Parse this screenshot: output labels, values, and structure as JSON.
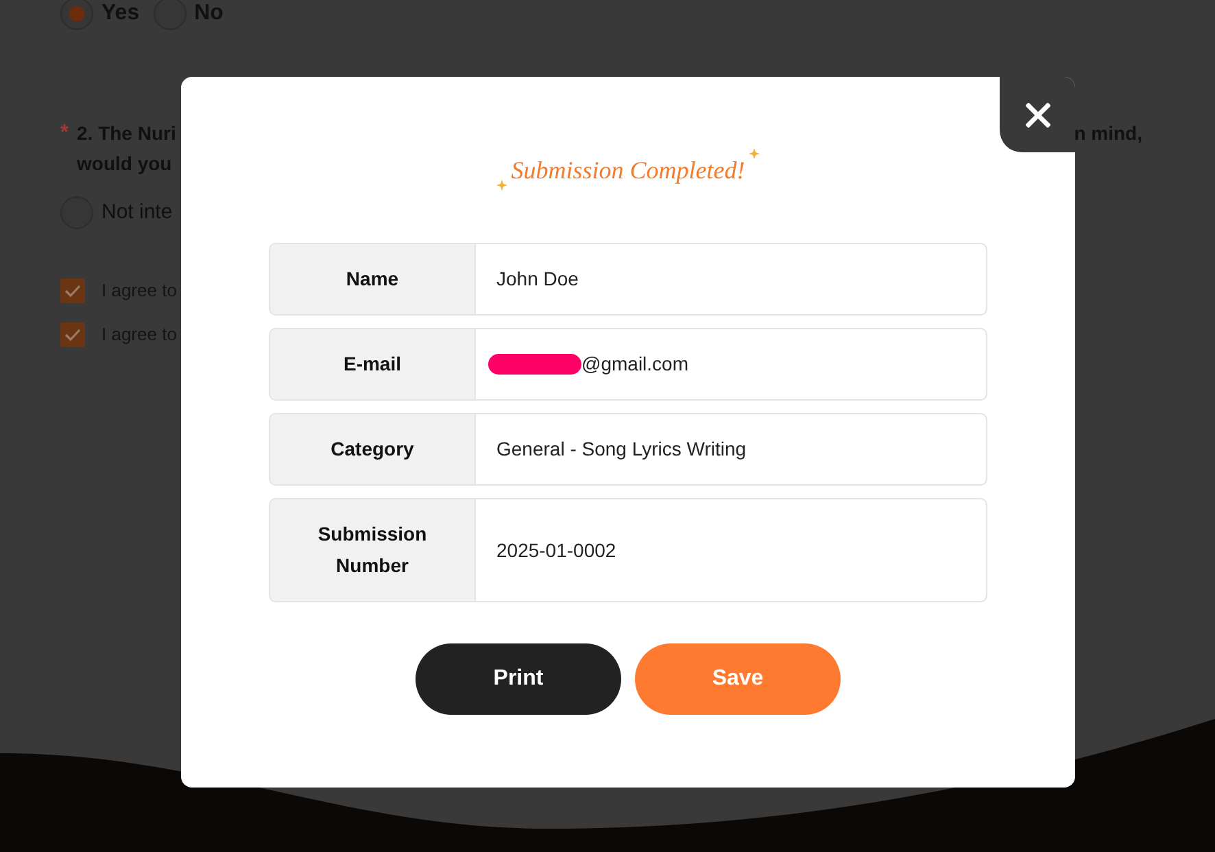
{
  "background_form": {
    "question_1_options": [
      {
        "label": "Yes",
        "selected": true
      },
      {
        "label": "No",
        "selected": false
      }
    ],
    "question_2": {
      "required_mark": "*",
      "text_left_lines": [
        "2. The Nuri",
        "would you"
      ],
      "text_right": "n mind,",
      "options": [
        {
          "label": "Not inte",
          "selected": false
        }
      ]
    },
    "agreements": [
      {
        "label": "I agree to",
        "checked": true
      },
      {
        "label": "I agree to",
        "checked": true
      }
    ]
  },
  "dialog": {
    "title": "Submission Completed!",
    "fields": [
      {
        "label": "Name",
        "value": "John Doe",
        "redacted": false
      },
      {
        "label": "E-mail",
        "value": "@gmail.com",
        "redacted": true
      },
      {
        "label": "Category",
        "value": "General - Song Lyrics Writing",
        "redacted": false
      },
      {
        "label": "Submission Number",
        "value": "2025-01-0002",
        "redacted": false
      }
    ],
    "buttons": [
      {
        "label": "Print",
        "kind": "dark"
      },
      {
        "label": "Save",
        "kind": "accent"
      }
    ]
  }
}
